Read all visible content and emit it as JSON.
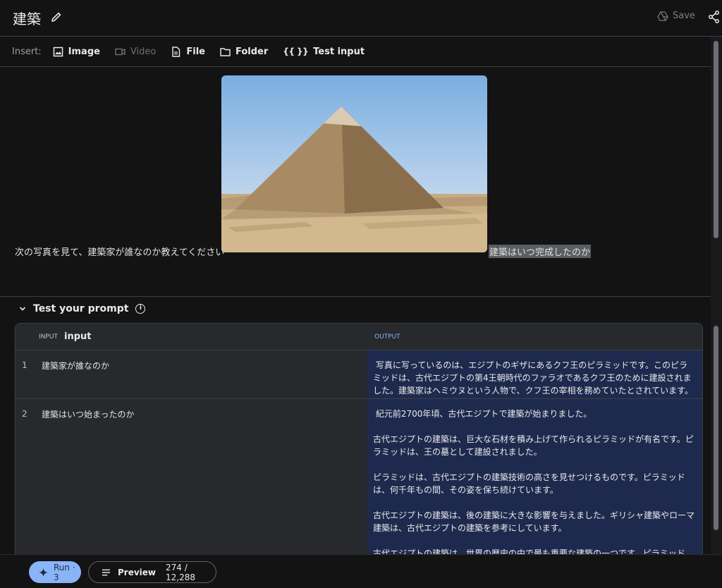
{
  "header": {
    "title": "建築",
    "save_label": "Save"
  },
  "toolbar": {
    "insert_label": "Insert:",
    "items": [
      {
        "label": "Image",
        "icon": "image-icon",
        "enabled": true
      },
      {
        "label": "Video",
        "icon": "video-icon",
        "enabled": false
      },
      {
        "label": "File",
        "icon": "file-icon",
        "enabled": true
      },
      {
        "label": "Folder",
        "icon": "folder-icon",
        "enabled": true
      },
      {
        "label": "Test input",
        "icon": "braces-icon",
        "enabled": true
      }
    ]
  },
  "prompt": {
    "text_before": "次の写真を見て、建築家が誰なのか教えてください",
    "text_after": "建築はいつ完成したのか",
    "image": "pyramid-photo"
  },
  "test": {
    "header": "Test your prompt",
    "input_tag": "INPUT",
    "input_name": "input",
    "output_tag": "OUTPUT",
    "rows": [
      {
        "num": "1",
        "input": "建築家が誰なのか",
        "output": " 写真に写っているのは、エジプトのギザにあるクフ王のピラミッドです。このピラミッドは、古代エジプトの第4王朝時代のファラオであるクフ王のために建設されました。建築家はヘミウヌという人物で、クフ王の宰相を務めていたとされています。"
      },
      {
        "num": "2",
        "input": "建築はいつ始まったのか",
        "output": " 紀元前2700年頃、古代エジプトで建築が始まりました。\n\n古代エジプトの建築は、巨大な石材を積み上げて作られるピラミッドが有名です。ピラミッドは、王の墓として建設されました。\n\nピラミッドは、古代エジプトの建築技術の高さを見せつけるものです。ピラミッドは、何千年もの間、その姿を保ち続けています。\n\n古代エジプトの建築は、後の建築に大きな影響を与えました。ギリシャ建築やローマ建築は、古代エジプトの建築を参考にしています。\n\n古代エジプトの建築は、世界の歴史の中で最も重要な建築の一つです。ピラミッドは、古代エジプトの文明の偉大さを象徴するものです。"
      }
    ]
  },
  "bottom": {
    "run_label": "Run · 3",
    "preview_label": "Preview",
    "token_count": "274 / 12,288"
  },
  "colors": {
    "background": "#131314",
    "accent": "#8ab4f8",
    "output_bg": "#1e2a4d"
  }
}
